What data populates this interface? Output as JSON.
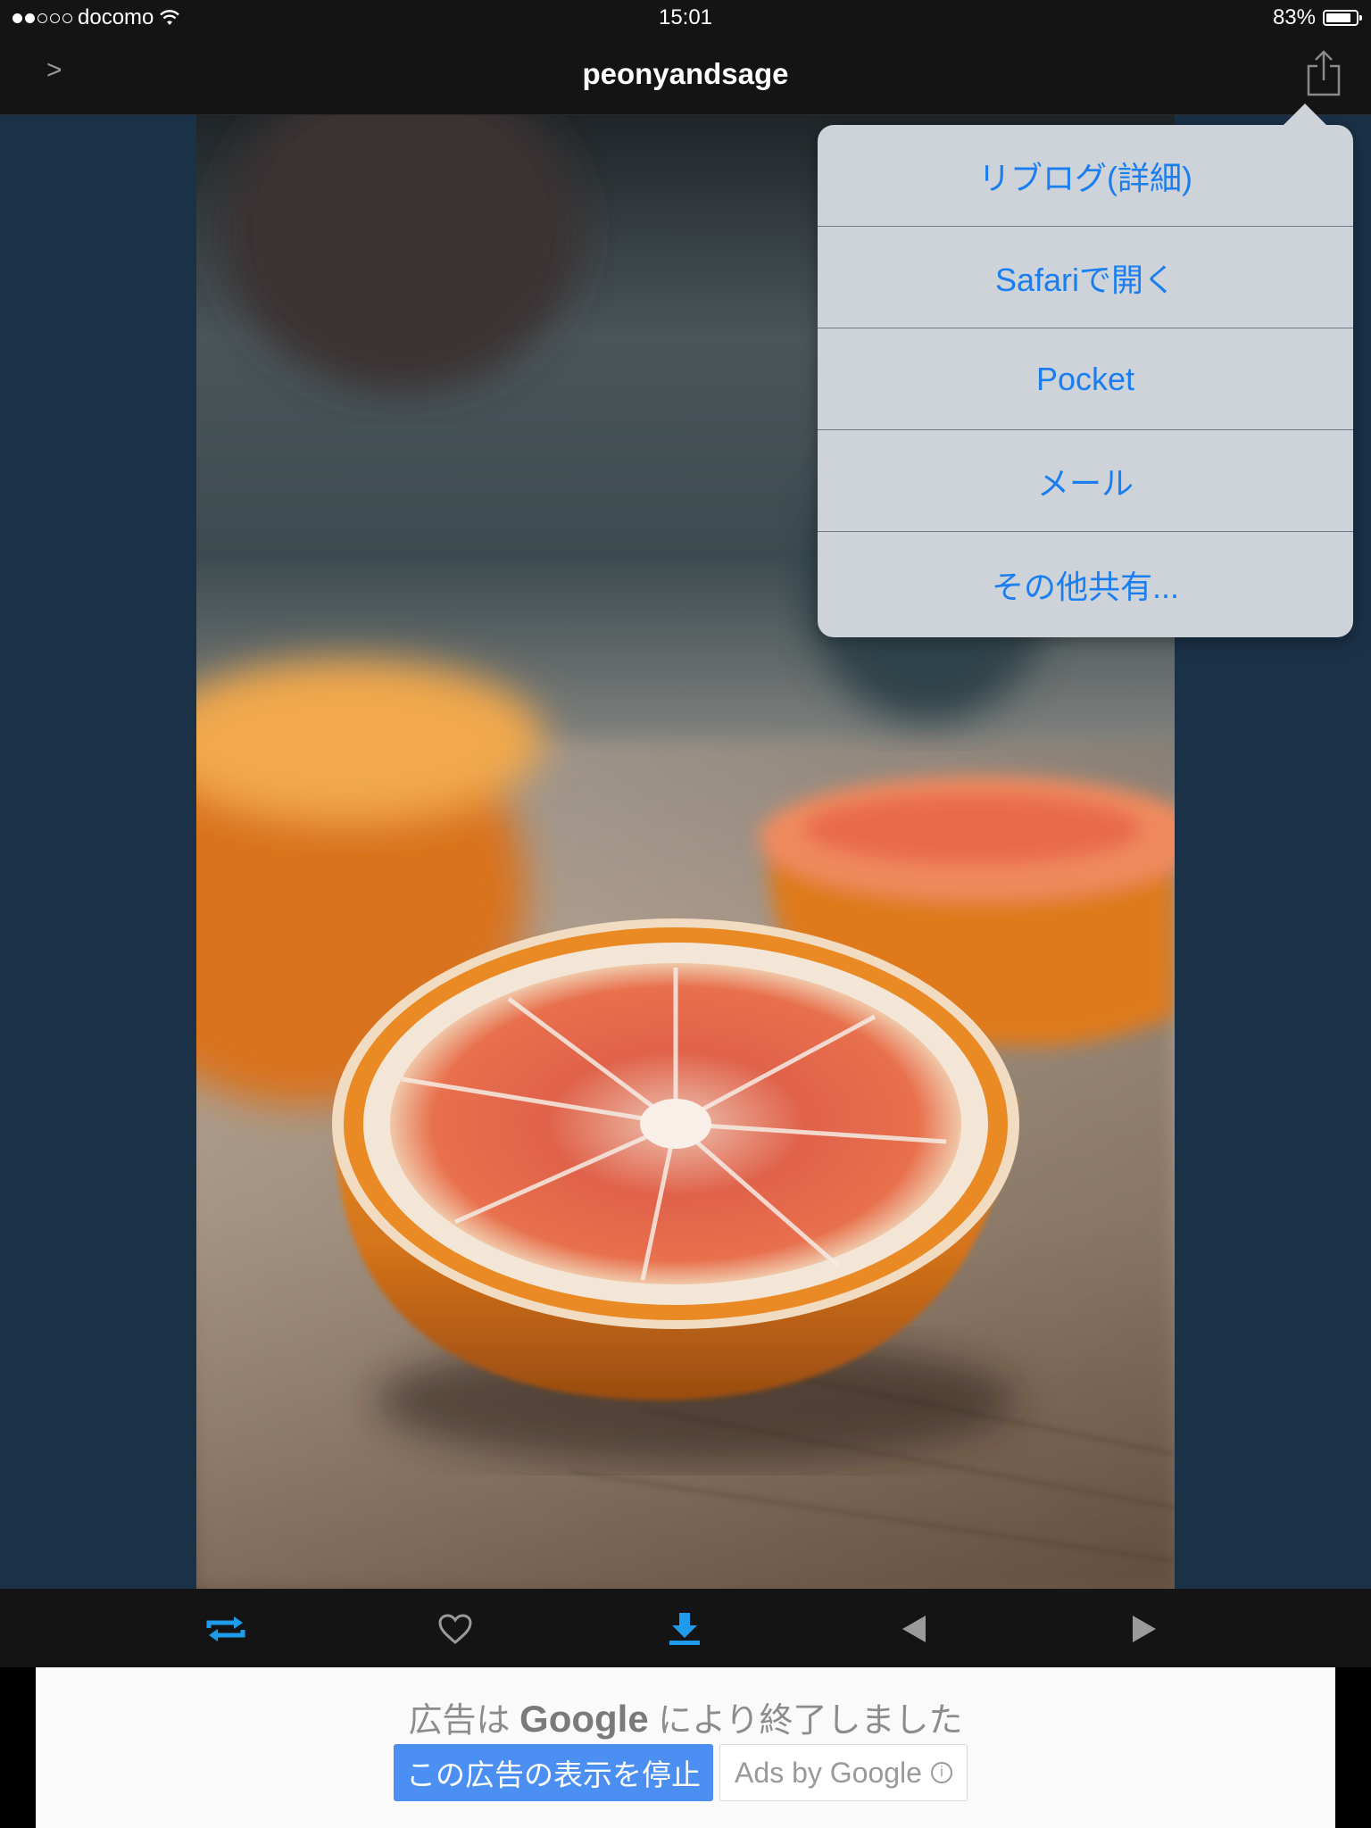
{
  "status_bar": {
    "signal_dots_filled": 2,
    "signal_dots_total": 5,
    "carrier": "docomo",
    "wifi_icon": "wifi-icon",
    "time": "15:01",
    "battery_percent": "83%",
    "battery_level": 0.83
  },
  "nav": {
    "back_label": ">",
    "title": "peonyandsage",
    "share_icon": "share-icon"
  },
  "photo": {
    "subject": "photo-blood-orange-halves"
  },
  "share_menu": {
    "items": [
      {
        "label": "リブログ(詳細)"
      },
      {
        "label": "Safariで開く"
      },
      {
        "label": "Pocket"
      },
      {
        "label": "メール"
      },
      {
        "label": "その他共有..."
      }
    ]
  },
  "toolbar": {
    "buttons": [
      {
        "icon": "reblog-icon",
        "color": "#1e9bea"
      },
      {
        "icon": "heart-icon",
        "color": "#9a9a9a"
      },
      {
        "icon": "download-icon",
        "color": "#1e9bea"
      },
      {
        "icon": "previous-icon",
        "color": "#9a9a9a"
      },
      {
        "icon": "next-icon",
        "color": "#9a9a9a"
      }
    ]
  },
  "ad": {
    "message_prefix": "広告は",
    "message_brand": "Google",
    "message_suffix": "により終了しました",
    "stop_button": "この広告の表示を停止",
    "ads_by": "Ads by Google",
    "info_icon": "info-icon"
  },
  "colors": {
    "accent_blue": "#1a7ef0",
    "bar_bg": "#141414",
    "page_bg": "#1b3147"
  }
}
